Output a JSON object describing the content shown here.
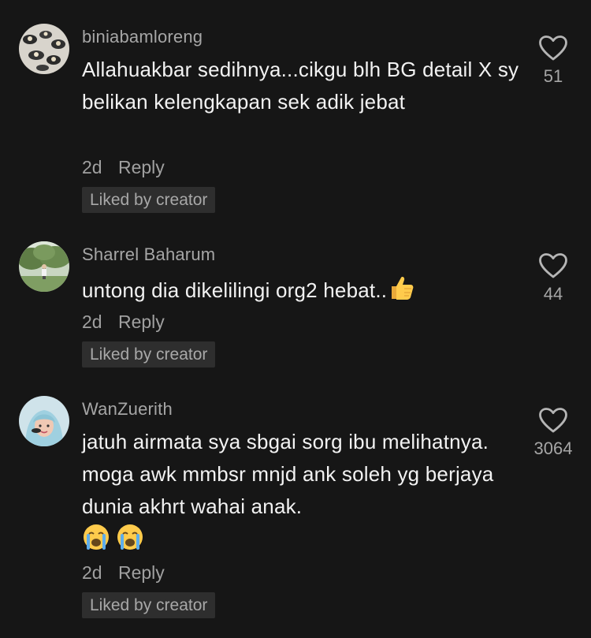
{
  "comments": [
    {
      "username": "biniabamloreng",
      "text": "Allahuakbar sedihnya...cikgu blh BG detail X sy belikan kelengkapan sek adik jebat",
      "time": "2d",
      "reply_label": "Reply",
      "badge": "Liked by creator",
      "likes": "51",
      "heart_icon": "heart-outline-icon"
    },
    {
      "username": "Sharrel Baharum",
      "text": "untong dia dikelilingi org2 hebat..",
      "emoji": "thumbs-up-emoji",
      "time": "2d",
      "reply_label": "Reply",
      "badge": "Liked by creator",
      "likes": "44",
      "heart_icon": "heart-outline-icon"
    },
    {
      "username": "WanZuerith",
      "text": "jatuh airmata sya sbgai sorg ibu melihatnya. moga awk mmbsr mnjd ank soleh yg berjaya dunia akhrt wahai anak.",
      "emoji": "loudly-crying-face-emoji",
      "time": "2d",
      "reply_label": "Reply",
      "badge": "Liked by creator",
      "likes": "3064",
      "heart_icon": "heart-outline-icon"
    }
  ],
  "colors": {
    "background": "#161616",
    "text": "#f2f2f2",
    "secondary": "#a6a6a6",
    "badge_bg": "#2e2e2e"
  }
}
